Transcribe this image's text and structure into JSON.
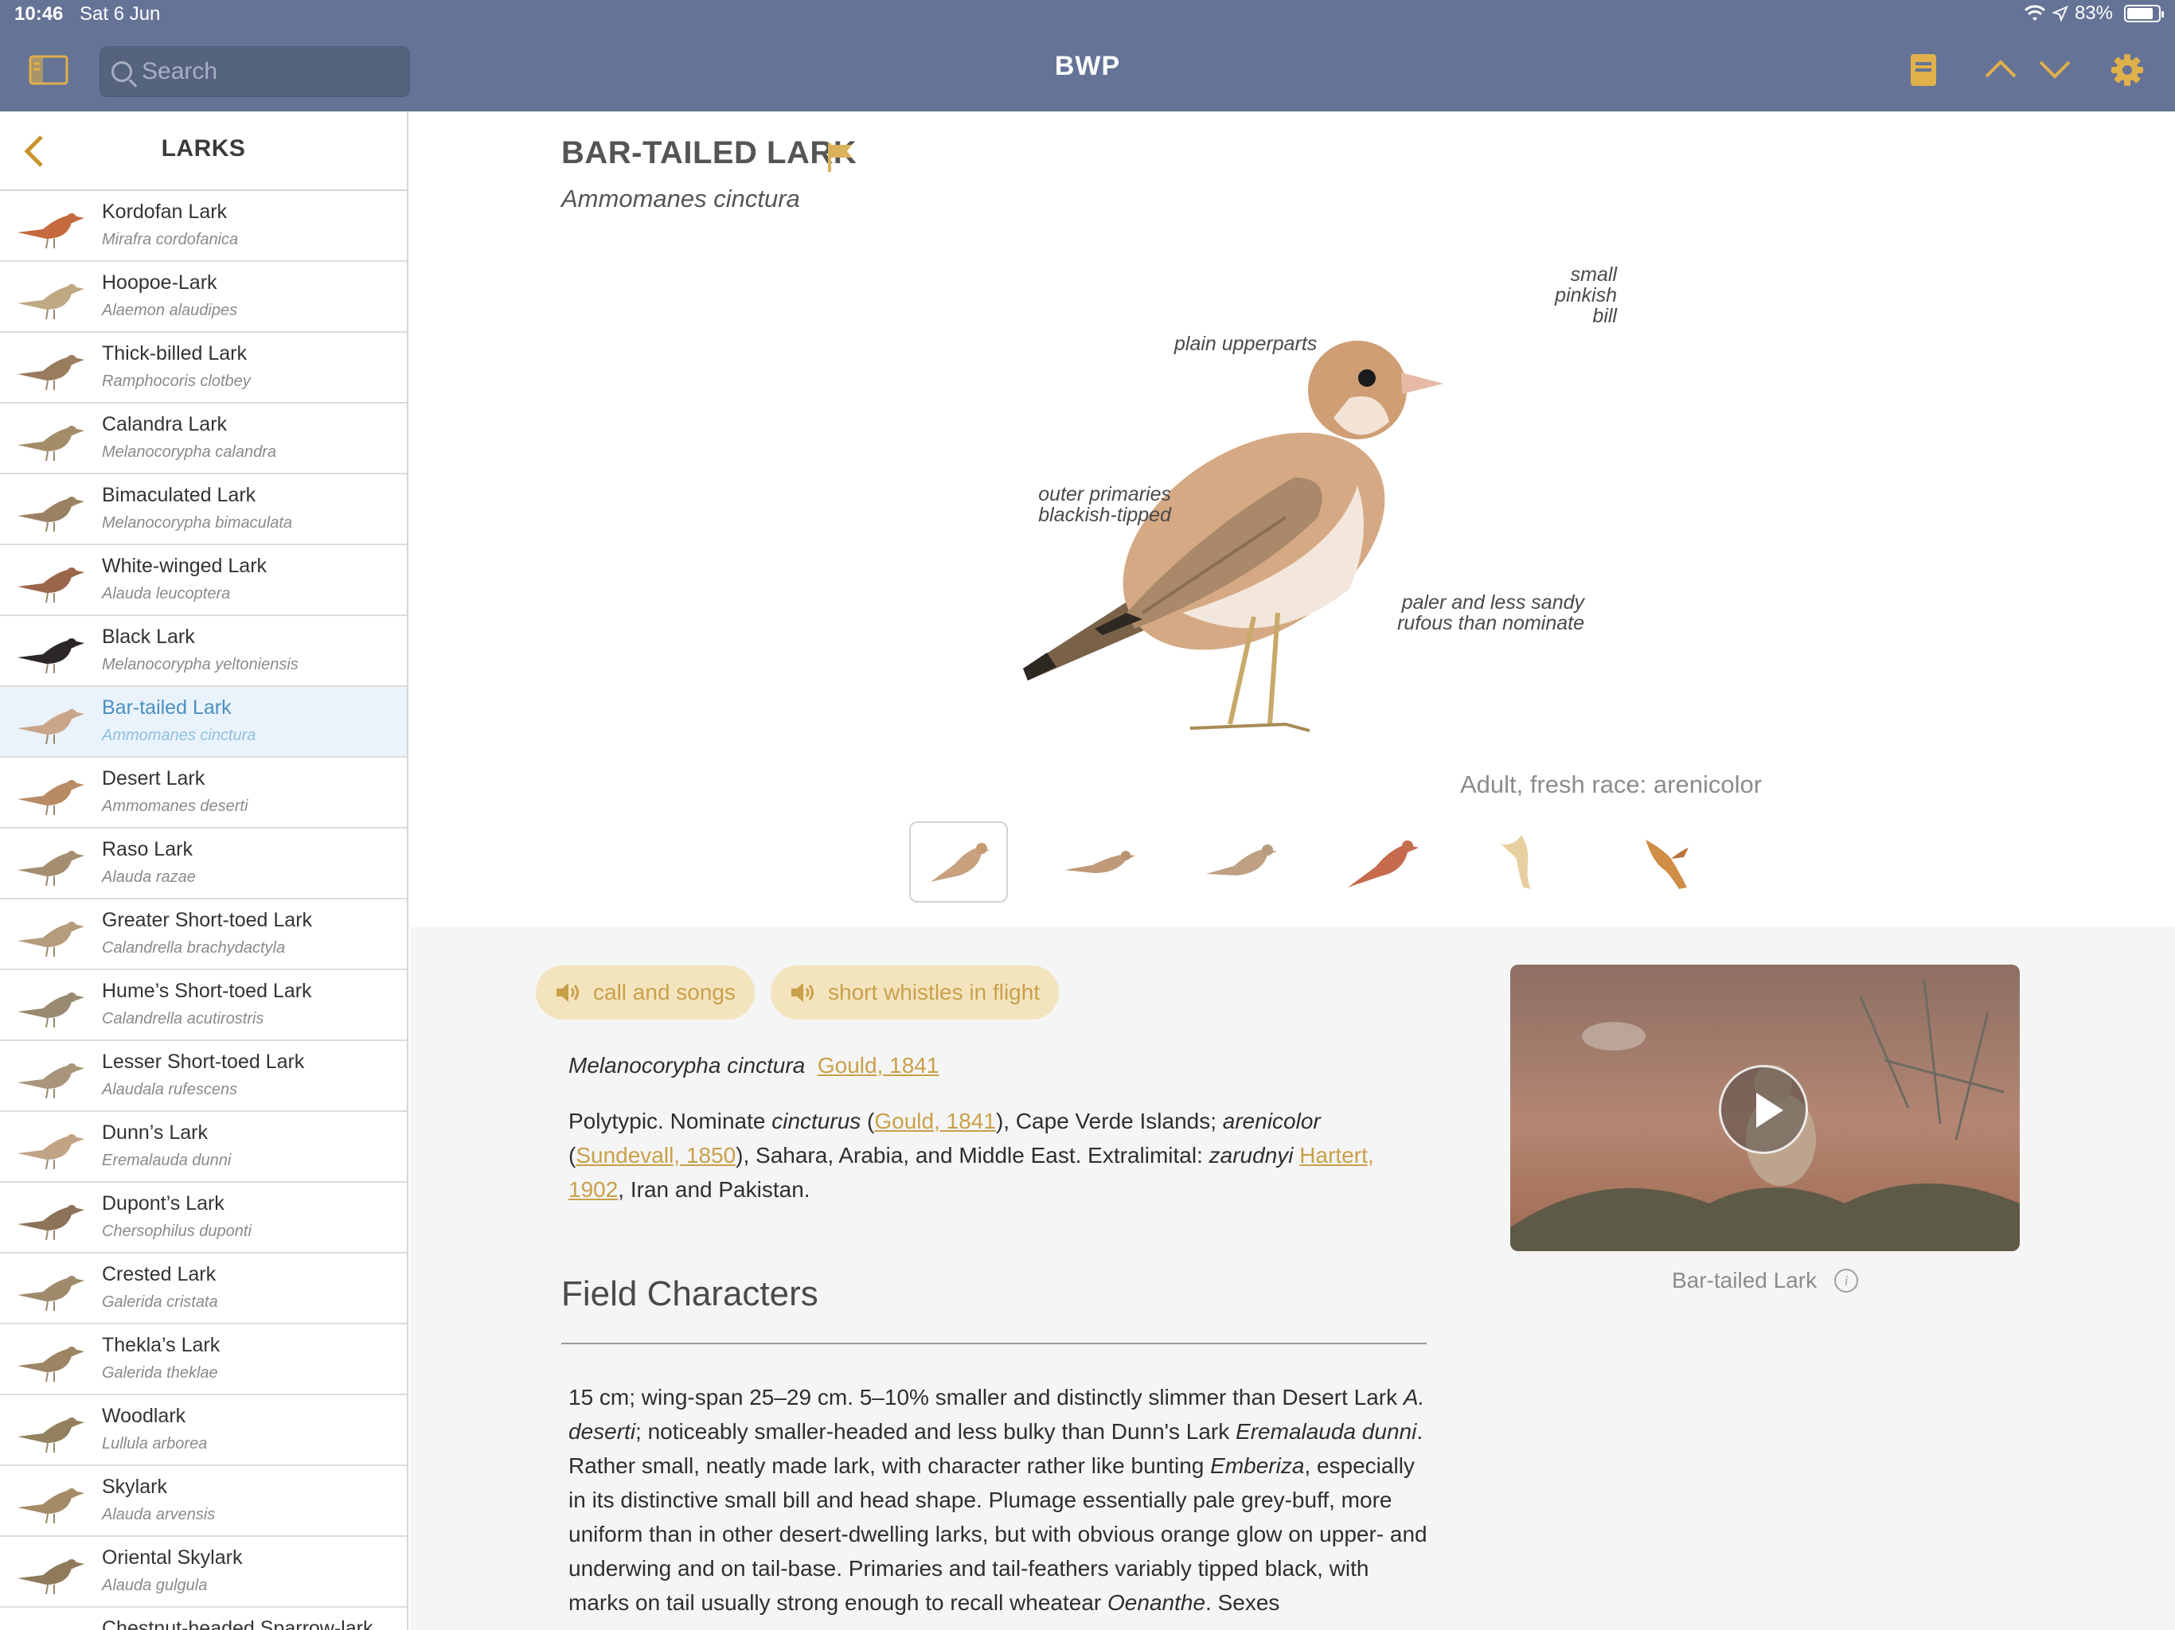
{
  "status": {
    "time": "10:46",
    "date": "Sat 6 Jun",
    "battery": "83%",
    "battery_level": 0.83
  },
  "topbar": {
    "title": "BWP",
    "search_placeholder": "Search"
  },
  "colors": {
    "bar": "#657396",
    "accent": "#c9a04a",
    "selected_row": "#eaf2fb",
    "selected_text": "#4a90c2"
  },
  "sidebar": {
    "heading": "LARKS",
    "items": [
      {
        "name": "Kordofan Lark",
        "sci": "Mirafra cordofanica"
      },
      {
        "name": "Hoopoe-Lark",
        "sci": "Alaemon alaudipes"
      },
      {
        "name": "Thick-billed Lark",
        "sci": "Ramphocoris clotbey"
      },
      {
        "name": "Calandra Lark",
        "sci": "Melanocorypha calandra"
      },
      {
        "name": "Bimaculated Lark",
        "sci": "Melanocorypha bimaculata"
      },
      {
        "name": "White-winged Lark",
        "sci": "Alauda leucoptera"
      },
      {
        "name": "Black Lark",
        "sci": "Melanocorypha yeltoniensis"
      },
      {
        "name": "Bar-tailed Lark",
        "sci": "Ammomanes cinctura"
      },
      {
        "name": "Desert Lark",
        "sci": "Ammomanes deserti"
      },
      {
        "name": "Raso Lark",
        "sci": "Alauda razae"
      },
      {
        "name": "Greater Short-toed Lark",
        "sci": "Calandrella brachydactyla"
      },
      {
        "name": "Hume’s Short-toed Lark",
        "sci": "Calandrella acutirostris"
      },
      {
        "name": "Lesser Short-toed Lark",
        "sci": "Alaudala rufescens"
      },
      {
        "name": "Dunn’s Lark",
        "sci": "Eremalauda dunni"
      },
      {
        "name": "Dupont’s Lark",
        "sci": "Chersophilus duponti"
      },
      {
        "name": "Crested Lark",
        "sci": "Galerida cristata"
      },
      {
        "name": "Thekla’s Lark",
        "sci": "Galerida theklae"
      },
      {
        "name": "Woodlark",
        "sci": "Lullula arborea"
      },
      {
        "name": "Skylark",
        "sci": "Alauda arvensis"
      },
      {
        "name": "Oriental Skylark",
        "sci": "Alauda gulgula"
      },
      {
        "name": "Chestnut-headed Sparrow-lark",
        "sci": ""
      }
    ],
    "selected_index": 7
  },
  "species": {
    "title": "BAR-TAILED LARK",
    "scientific": "Ammomanes cinctura",
    "annotations": {
      "bill": [
        "small",
        "pinkish",
        "bill"
      ],
      "upperparts": "plain upperparts",
      "primaries": [
        "outer primaries",
        "blackish-tipped"
      ],
      "paler": [
        "paler and less sandy",
        "rufous than nominate"
      ]
    },
    "plate_caption": "Adult, fresh race: arenicolor",
    "plate_thumbnails": [
      "adult-bird-icon",
      "bird-variant-2-icon",
      "bird-variant-3-icon",
      "rufous-bird-icon",
      "flight-from-below-icon",
      "flight-from-above-icon"
    ]
  },
  "audio": [
    {
      "label": "call and songs",
      "icon": "speaker-icon"
    },
    {
      "label": "short whistles in flight",
      "icon": "speaker-icon"
    }
  ],
  "video": {
    "caption": "Bar-tailed Lark"
  },
  "text": {
    "synonym_name": "Melanocorypha cinctura",
    "synonym_author": "Gould, 1841",
    "p1_a": "Polytypic. Nominate ",
    "p1_b": "cincturus",
    "p1_c": " (",
    "p1_d": "Gould, 1841",
    "p1_e": "), Cape Verde Islands; ",
    "p1_f": "arenicolor",
    "p1_g": "(",
    "p1_h": "Sundevall, 1850",
    "p1_i": "), Sahara, Arabia, and Middle East. Extralimital: ",
    "p1_j": "zarudnyi",
    "p1_k": " ",
    "p1_l": "Hartert, 1902",
    "p1_m": ", Iran and Pakistan.",
    "section_title": "Field Characters",
    "fc_1": "15 cm; wing-span 25–29 cm. 5–10% smaller and distinctly slimmer than Desert Lark ",
    "fc_2": "A. deserti",
    "fc_3": "; noticeably smaller-headed and less bulky than Dunn's Lark ",
    "fc_4": "Eremalauda dunni",
    "fc_5": ". Rather small, neatly made lark, with character rather like bunting ",
    "fc_6": "Emberiza",
    "fc_7": ", especially in its distinctive small bill and head shape. Plumage essentially pale grey-buff, more uniform than in other desert-dwelling larks, but with obvious orange glow on upper- and underwing and on tail-base. Primaries and tail-feathers variably tipped black, with marks on tail usually strong enough to recall wheatear ",
    "fc_8": "Oenanthe",
    "fc_9": ". Sexes"
  }
}
